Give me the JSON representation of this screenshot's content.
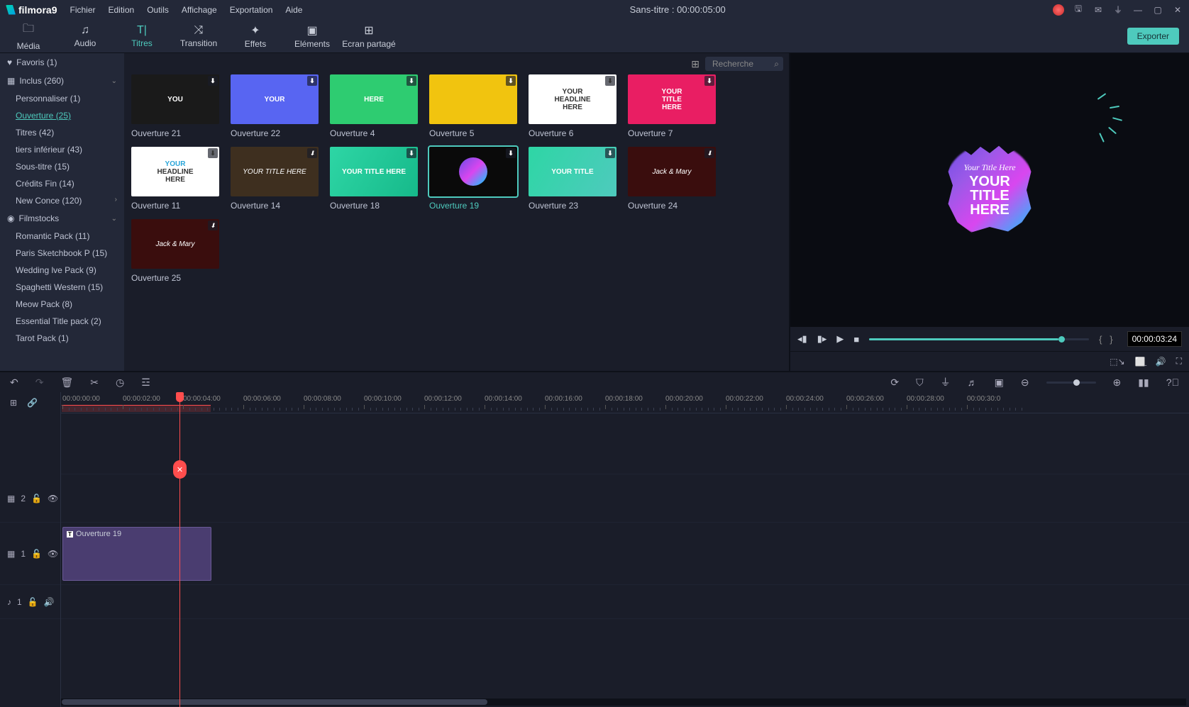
{
  "app": {
    "name": "filmora",
    "version": "9",
    "title": "Sans-titre : 00:00:05:00"
  },
  "menu": {
    "file": "Fichier",
    "edit": "Edition",
    "tools": "Outils",
    "view": "Affichage",
    "export": "Exportation",
    "help": "Aide"
  },
  "tabs": {
    "media": "Média",
    "audio": "Audio",
    "titles": "Titres",
    "transition": "Transition",
    "effects": "Effets",
    "elements": "Eléments",
    "split": "Ecran partagé"
  },
  "export_btn": "Exporter",
  "search_placeholder": "Recherche",
  "sidebar": {
    "favoris": "Favoris (1)",
    "inclus": "Inclus (260)",
    "items": [
      "Personnaliser (1)",
      "Ouverture (25)",
      "Titres (42)",
      "tiers inférieur (43)",
      "Sous-titre (15)",
      "Crédits Fin (14)",
      "New Conce (120)"
    ],
    "filmstocks": "Filmstocks",
    "fsitems": [
      "Romantic Pack (11)",
      "Paris Sketchbook P (15)",
      "Wedding lve Pack (9)",
      "Spaghetti Western  (15)",
      "Meow Pack (8)",
      "Essential Title pack (2)",
      "Tarot Pack (1)"
    ]
  },
  "thumbs": [
    {
      "label": "Ouverture 21",
      "cls": "t21",
      "txt": "YOU"
    },
    {
      "label": "Ouverture 22",
      "cls": "t22",
      "txt": "YOUR"
    },
    {
      "label": "Ouverture 4",
      "cls": "t4",
      "txt": "HERE"
    },
    {
      "label": "Ouverture 5",
      "cls": "t5",
      "txt": ""
    },
    {
      "label": "Ouverture 6",
      "cls": "t6",
      "txt": "YOUR\nHEADLINE\nHERE"
    },
    {
      "label": "Ouverture 7",
      "cls": "t7",
      "txt": "YOUR\nTITLE\nHERE"
    },
    {
      "label": "Ouverture 11",
      "cls": "t11",
      "txt": "YOUR\nHEADLINE\nHERE"
    },
    {
      "label": "Ouverture 14",
      "cls": "t14",
      "txt": "YOUR TITLE HERE"
    },
    {
      "label": "Ouverture 18",
      "cls": "t18",
      "txt": "YOUR TITLE HERE"
    },
    {
      "label": "Ouverture 19",
      "cls": "t19",
      "txt": "",
      "selected": true
    },
    {
      "label": "Ouverture 23",
      "cls": "t23",
      "txt": "YOUR TITLE"
    },
    {
      "label": "Ouverture 24",
      "cls": "t24",
      "txt": "Jack & Mary"
    },
    {
      "label": "Ouverture 25",
      "cls": "t25",
      "txt": "Jack & Mary"
    }
  ],
  "preview": {
    "small": "Your Title Here",
    "big1": "YOUR",
    "big2": "TITLE",
    "big3": "HERE",
    "time": "00:00:03:24"
  },
  "timeline": {
    "marks": [
      "00:00:00:00",
      "00:00:02:00",
      "00:00:04:00",
      "00:00:06:00",
      "00:00:08:00",
      "00:00:10:00",
      "00:00:12:00",
      "00:00:14:00",
      "00:00:16:00",
      "00:00:18:00",
      "00:00:20:00",
      "00:00:22:00",
      "00:00:24:00",
      "00:00:26:00",
      "00:00:28:00",
      "00:00:30:0"
    ],
    "track2": "2",
    "track1": "1",
    "audio1": "1",
    "clip": "Ouverture 19"
  }
}
